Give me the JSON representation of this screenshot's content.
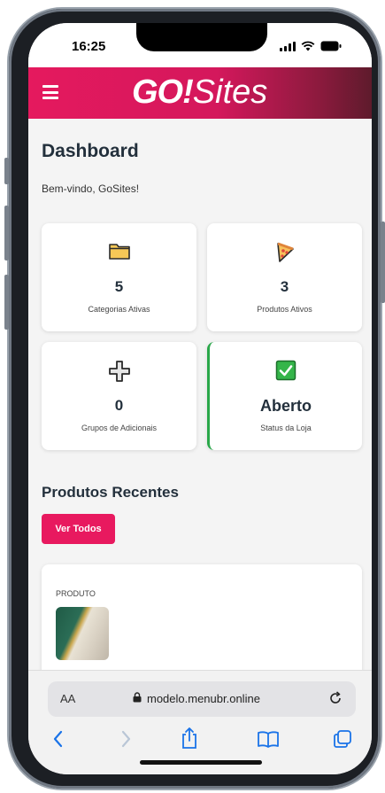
{
  "status_bar": {
    "time": "16:25"
  },
  "header": {
    "logo_bold": "GO!",
    "logo_light": "Sites"
  },
  "dashboard": {
    "title": "Dashboard",
    "welcome": "Bem-vindo, GoSites!",
    "cards": [
      {
        "icon": "folder-icon",
        "value": "5",
        "label": "Categorias Ativas"
      },
      {
        "icon": "pizza-icon",
        "value": "3",
        "label": "Produtos Ativos"
      },
      {
        "icon": "plus-icon",
        "value": "0",
        "label": "Grupos de Adicionais"
      },
      {
        "icon": "check-box-icon",
        "value": "Aberto",
        "label": "Status da Loja",
        "accent": "#2aa84a"
      }
    ]
  },
  "recent_products": {
    "title": "Produtos Recentes",
    "view_all_label": "Ver Todos",
    "column_header": "PRODUTO"
  },
  "browser": {
    "text_size_label": "AA",
    "url": "modelo.menubr.online"
  },
  "colors": {
    "brand": "#e5195e",
    "header_gradient_end": "#5e1b2c",
    "open_status": "#2aa84a"
  }
}
